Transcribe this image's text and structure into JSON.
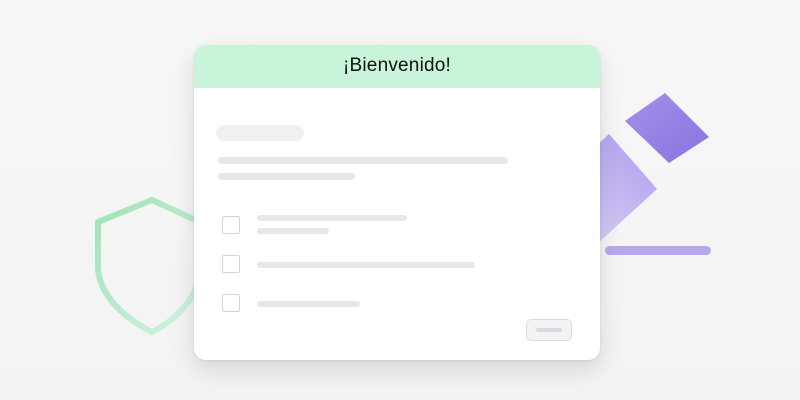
{
  "dialog": {
    "title": "¡Bienvenido!"
  },
  "colors": {
    "header_bg": "#c8f5d9",
    "shield_stroke": "#9fe2b7",
    "pencil": "#9b86e6",
    "skeleton": "#e7e7e9"
  },
  "icons": {
    "shield": "shield-icon",
    "pencil": "pencil-icon"
  },
  "checklist": {
    "count": 3
  }
}
